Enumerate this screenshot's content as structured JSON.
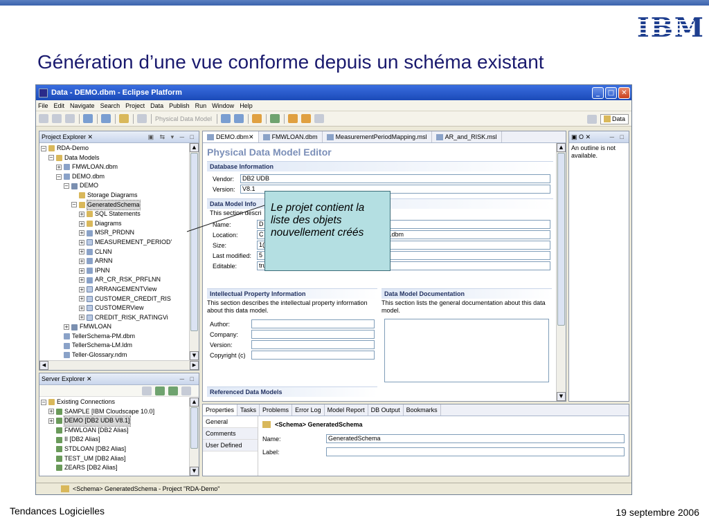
{
  "slide": {
    "title": "Génération d’une vue conforme depuis un schéma existant",
    "logo_text": "IBM",
    "footer_left": "Tendances Logicielles",
    "footer_right": "19 septembre 2006"
  },
  "window": {
    "title": "Data - DEMO.dbm - Eclipse Platform",
    "menu": [
      "File",
      "Edit",
      "Navigate",
      "Search",
      "Project",
      "Data",
      "Publish",
      "Run",
      "Window",
      "Help"
    ],
    "toolbar_label": "Physical Data Model",
    "perspective": "Data"
  },
  "project_explorer": {
    "title": "Project Explorer",
    "tree": [
      {
        "label": "RDA-Demo",
        "indent": 0,
        "exp": "−",
        "icon": "project-icon"
      },
      {
        "label": "Data Models",
        "indent": 1,
        "exp": "−",
        "icon": "folder-icon"
      },
      {
        "label": "FMWLOAN.dbm",
        "indent": 2,
        "exp": "+",
        "icon": "model-icon"
      },
      {
        "label": "DEMO.dbm",
        "indent": 2,
        "exp": "−",
        "icon": "model-icon"
      },
      {
        "label": "DEMO",
        "indent": 3,
        "exp": "−",
        "icon": "database-icon"
      },
      {
        "label": "Storage Diagrams",
        "indent": 4,
        "exp": "",
        "icon": "diagram-icon"
      },
      {
        "label": "GeneratedSchema",
        "indent": 4,
        "exp": "−",
        "icon": "schema-icon",
        "selected": true
      },
      {
        "label": "SQL Statements",
        "indent": 5,
        "exp": "+",
        "icon": "folder-icon"
      },
      {
        "label": "Diagrams",
        "indent": 5,
        "exp": "+",
        "icon": "folder-icon"
      },
      {
        "label": "MSR_PRDNN",
        "indent": 5,
        "exp": "+",
        "icon": "table-icon"
      },
      {
        "label": "MEASUREMENT_PERIOD’",
        "indent": 5,
        "exp": "+",
        "icon": "view-icon"
      },
      {
        "label": "CLNN",
        "indent": 5,
        "exp": "+",
        "icon": "table-icon"
      },
      {
        "label": "ARNN",
        "indent": 5,
        "exp": "+",
        "icon": "table-icon"
      },
      {
        "label": "IPNN",
        "indent": 5,
        "exp": "+",
        "icon": "table-icon"
      },
      {
        "label": "AR_CR_RSK_PRFLNN",
        "indent": 5,
        "exp": "+",
        "icon": "table-icon"
      },
      {
        "label": "ARRANGEMENTView",
        "indent": 5,
        "exp": "+",
        "icon": "view-icon"
      },
      {
        "label": "CUSTOMER_CREDIT_RIS",
        "indent": 5,
        "exp": "+",
        "icon": "view-icon"
      },
      {
        "label": "CUSTOMERView",
        "indent": 5,
        "exp": "+",
        "icon": "view-icon"
      },
      {
        "label": "CREDIT_RISK_RATINGVi",
        "indent": 5,
        "exp": "+",
        "icon": "view-icon"
      },
      {
        "label": "FMWLOAN",
        "indent": 3,
        "exp": "+",
        "icon": "database-icon"
      },
      {
        "label": "TellerSchema-PM.dbm",
        "indent": 2,
        "exp": "",
        "icon": "model-icon"
      },
      {
        "label": "TellerSchema-LM.ldm",
        "indent": 2,
        "exp": "",
        "icon": "model-icon"
      },
      {
        "label": "Teller-Glossary.ndm",
        "indent": 2,
        "exp": "",
        "icon": "model-icon"
      }
    ]
  },
  "server_explorer": {
    "title": "Server Explorer",
    "tree": [
      {
        "label": "Existing Connections",
        "indent": 0,
        "exp": "−",
        "icon": "folder-icon"
      },
      {
        "label": "SAMPLE [IBM Cloudscape 10.0]",
        "indent": 1,
        "exp": "+",
        "icon": "connection-icon"
      },
      {
        "label": "DEMO [DB2 UDB V8.1]",
        "indent": 1,
        "exp": "+",
        "icon": "connection-icon",
        "selected": true
      },
      {
        "label": "FMWLOAN [DB2 Alias]",
        "indent": 1,
        "exp": "",
        "icon": "connection-icon"
      },
      {
        "label": "II [DB2 Alias]",
        "indent": 1,
        "exp": "",
        "icon": "connection-icon"
      },
      {
        "label": "STDLOAN [DB2 Alias]",
        "indent": 1,
        "exp": "",
        "icon": "connection-icon"
      },
      {
        "label": "TEST_UM [DB2 Alias]",
        "indent": 1,
        "exp": "",
        "icon": "connection-icon"
      },
      {
        "label": "ZEARS [DB2 Alias]",
        "indent": 1,
        "exp": "",
        "icon": "connection-icon"
      }
    ]
  },
  "editor": {
    "tabs": [
      "DEMO.dbm",
      "FMWLOAN.dbm",
      "MeasurementPeriodMapping.msl",
      "AR_and_RISK.msl"
    ],
    "title": "Physical Data Model Editor",
    "db_info": {
      "heading": "Database Information",
      "vendor_label": "Vendor:",
      "vendor": "DB2 UDB",
      "version_label": "Version:",
      "version": "V8.1"
    },
    "model_info": {
      "heading": "Data Model Info",
      "desc": "This section descri",
      "name_label": "Name:",
      "name": "D",
      "location_label": "Location:",
      "location": "C",
      "location_tail": ").dbm",
      "size_label": "Size:",
      "size": "1(",
      "modified_label": "Last modified:",
      "modified": "5",
      "editable_label": "Editable:",
      "editable": "true"
    },
    "ip": {
      "heading": "Intellectual Property Information",
      "desc": "This section describes the intellectual property information about this data model.",
      "author": "Author:",
      "company": "Company:",
      "version": "Version:",
      "copyright": "Copyright (c)"
    },
    "doc": {
      "heading": "Data Model Documentation",
      "desc": "This section lists the general documentation about this data model."
    },
    "ref_heading": "Referenced Data Models"
  },
  "outline": {
    "message": "An outline is not available."
  },
  "properties": {
    "tabs": [
      "Properties",
      "Tasks",
      "Problems",
      "Error Log",
      "Model Report",
      "DB Output",
      "Bookmarks"
    ],
    "side": [
      "General",
      "Comments",
      "User Defined"
    ],
    "header": "<Schema> GeneratedSchema",
    "name_label": "Name:",
    "name": "GeneratedSchema",
    "label_label": "Label:",
    "label": ""
  },
  "status": "<Schema> GeneratedSchema - Project \"RDA-Demo\"",
  "callout": "Le projet contient la liste des objets nouvellement créés"
}
